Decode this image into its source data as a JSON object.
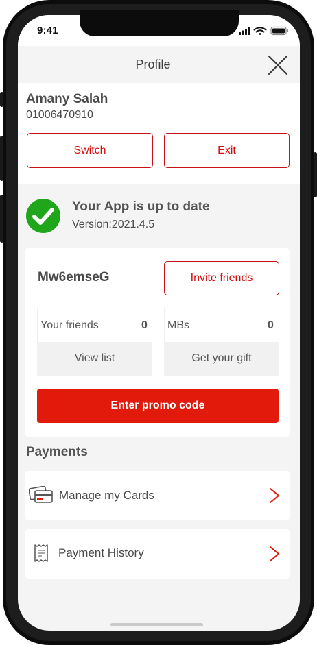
{
  "status_bar": {
    "time": "9:41"
  },
  "header": {
    "title": "Profile"
  },
  "user": {
    "name": "Amany Salah",
    "phone": "01006470910",
    "switch_label": "Switch",
    "exit_label": "Exit"
  },
  "update": {
    "title": "Your App is up to date",
    "version": "Version:2021.4.5"
  },
  "invite": {
    "code": "Mw6emseG",
    "invite_label": "Invite friends",
    "friends_label": "Your friends",
    "friends_count": "0",
    "mbs_label": "MBs",
    "mbs_count": "0",
    "view_list_label": "View list",
    "gift_label": "Get your gift",
    "promo_label": "Enter promo code"
  },
  "payments": {
    "title": "Payments",
    "items": [
      {
        "label": "Manage my Cards",
        "icon": "credit-card-icon"
      },
      {
        "label": "Payment History",
        "icon": "receipt-icon"
      }
    ]
  },
  "colors": {
    "accent": "#e11a0c",
    "success": "#1fa61a"
  }
}
